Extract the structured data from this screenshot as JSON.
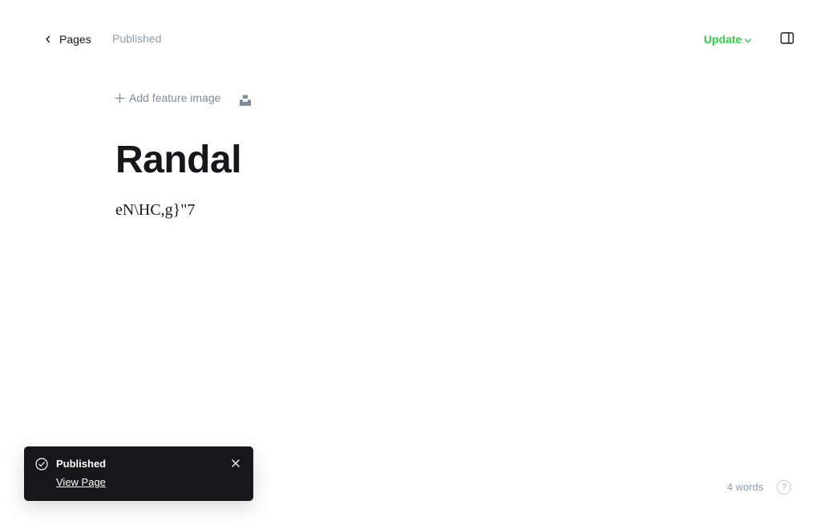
{
  "header": {
    "back_label": "Pages",
    "status": "Published",
    "update_label": "Update"
  },
  "editor": {
    "add_feature_image_label": "Add feature image",
    "title": "Randal",
    "body": "eN\\HC,g}\"7"
  },
  "footer": {
    "word_count": "4 words",
    "help_symbol": "?"
  },
  "toast": {
    "title": "Published",
    "link_label": "View Page"
  },
  "colors": {
    "accent_green": "#30cf43",
    "toast_bg": "#15171a",
    "muted_text": "#8e9cac"
  },
  "icons": [
    "chevron-left-icon",
    "chevron-down-icon",
    "sidebar-toggle-icon",
    "plus-icon",
    "unsplash-icon",
    "check-circle-icon",
    "close-icon",
    "help-icon"
  ]
}
